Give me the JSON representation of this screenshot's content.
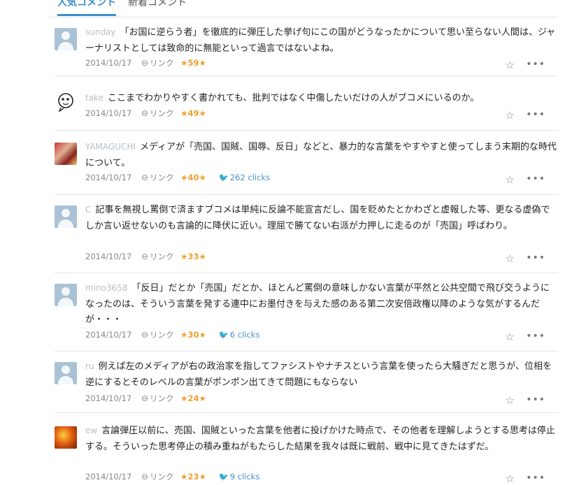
{
  "tabs": {
    "popular": "人気コメント",
    "new": "新着コメント"
  },
  "comments": [
    {
      "user": "sunday",
      "avatar": "default",
      "text": "「お国に逆らう者」を徹底的に弾圧した挙げ句にこの国がどうなったかについて思い至らない人間は、ジャーナリストとしては致命的に無能といって過言ではないよね。",
      "date": "2014/10/17",
      "link": "リンク",
      "stars": "★59★",
      "clicks": ""
    },
    {
      "user": "take",
      "avatar": "face",
      "text": "ここまでわかりやすく書かれても、批判ではなく中傷したいだけの人がブコメにいるのか。",
      "date": "2014/10/17",
      "link": "リンク",
      "stars": "★49★",
      "clicks": ""
    },
    {
      "user": "YAMAGUCHI",
      "avatar": "photo-red",
      "text": "メディアが「売国、国賊、国辱、反日」などと、暴力的な言葉をやすやすと使ってしまう末期的な時代について。",
      "date": "2014/10/17",
      "link": "リンク",
      "stars": "★40★",
      "clicks": "262 clicks"
    },
    {
      "user": "C",
      "avatar": "default",
      "text": "記事を無視し罵倒で済ますブコメは単純に反論不能宣言だし、国を貶めたとかわざと虚報した等、更なる虚偽でしか言い返せないのも言論的に降伏に近い。理屈で勝てない右派が力押しに走るのが「売国」呼ばわり。",
      "date": "2014/10/17",
      "link": "リンク",
      "stars": "★33★",
      "clicks": ""
    },
    {
      "user": "mino3658",
      "avatar": "default",
      "text": "「反日」だとか「売国」だとか、ほとんど罵倒の意味しかない言葉が平然と公共空間で飛び交うようになったのは、そういう言葉を発する連中にお墨付きを与えた感のある第二次安倍政権以降のような気がするんだが・・・",
      "date": "2014/10/17",
      "link": "リンク",
      "stars": "★30★",
      "clicks": "6 clicks"
    },
    {
      "user": "ru",
      "avatar": "default",
      "text": "例えば左のメディアが右の政治家を指してファシストやナチスという言葉を使ったら大騒ぎだと思うが、位相を逆にするとそのレベルの言葉がポンポン出てきて問題にもならない",
      "date": "2014/10/17",
      "link": "リンク",
      "stars": "★24★",
      "clicks": ""
    },
    {
      "user": "ew",
      "avatar": "photo-fire",
      "text": "言論弾圧以前に、売国、国賊といった言葉を他者に投げかけた時点で、その他者を理解しようとする思考は停止する。そういった思考停止の積み重ねがもたらした結果を我々は既に戦前、戦中に見てきたはずだ。",
      "date": "2014/10/17",
      "link": "リンク",
      "stars": "★23★",
      "clicks": "9 clicks"
    }
  ],
  "icons": {
    "link": "link-chain-icon",
    "star_add": "star-plus-icon",
    "more": "more-dots-icon",
    "twitter": "twitter-bird-icon"
  }
}
